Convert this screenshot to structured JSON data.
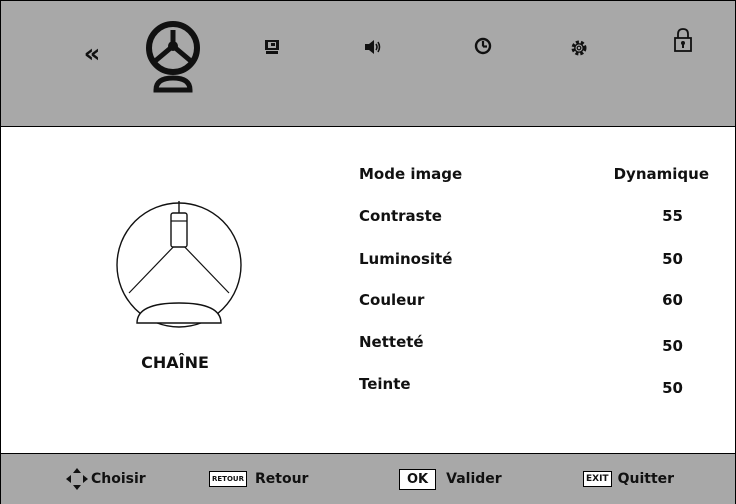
{
  "menu": {
    "back_icon": "double-chevron-left-icon",
    "tabs": [
      {
        "id": "image",
        "icon": "picture-icon"
      },
      {
        "id": "source",
        "icon": "screen-icon"
      },
      {
        "id": "sound",
        "icon": "speaker-icon"
      },
      {
        "id": "time",
        "icon": "clock-icon"
      },
      {
        "id": "settings",
        "icon": "gear-icon"
      },
      {
        "id": "lock",
        "icon": "lock-icon"
      }
    ]
  },
  "panel": {
    "section_label": "CHAÎNE",
    "items": [
      {
        "label": "Mode image",
        "value": "Dynamique"
      },
      {
        "label": "Contraste",
        "value": "55"
      },
      {
        "label": "Luminosité",
        "value": "50"
      },
      {
        "label": "Couleur",
        "value": "60"
      },
      {
        "label": "Netteté",
        "value": "50"
      },
      {
        "label": "Teinte",
        "value": "50"
      }
    ]
  },
  "footer": {
    "choose_label": "Choisir",
    "retour_key": "RETOUR",
    "retour_label": "Retour",
    "ok_key": "OK",
    "ok_label": "Valider",
    "exit_key": "EXIT",
    "exit_label": "Quitter"
  },
  "colors": {
    "bar": "#a8a8a8",
    "background": "#ffffff",
    "text": "#111111"
  }
}
